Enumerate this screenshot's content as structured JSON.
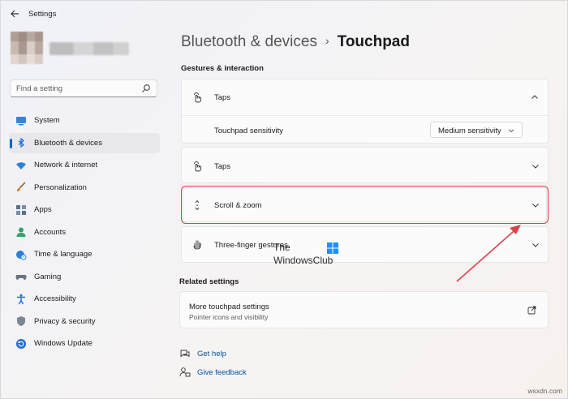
{
  "window": {
    "title": "Settings"
  },
  "search": {
    "placeholder": "Find a setting"
  },
  "sidebar": {
    "items": [
      {
        "label": "System",
        "icon": "system-icon"
      },
      {
        "label": "Bluetooth & devices",
        "icon": "bluetooth-icon",
        "active": true
      },
      {
        "label": "Network & internet",
        "icon": "wifi-icon"
      },
      {
        "label": "Personalization",
        "icon": "brush-icon"
      },
      {
        "label": "Apps",
        "icon": "apps-icon"
      },
      {
        "label": "Accounts",
        "icon": "person-icon"
      },
      {
        "label": "Time & language",
        "icon": "globe-clock-icon"
      },
      {
        "label": "Gaming",
        "icon": "controller-icon"
      },
      {
        "label": "Accessibility",
        "icon": "accessibility-icon"
      },
      {
        "label": "Privacy & security",
        "icon": "shield-icon"
      },
      {
        "label": "Windows Update",
        "icon": "update-icon"
      }
    ]
  },
  "header": {
    "parent": "Bluetooth & devices",
    "separator": "›",
    "current": "Touchpad"
  },
  "gestures": {
    "section_title": "Gestures & interaction",
    "taps_expanded": {
      "label": "Taps",
      "sensitivity_label": "Touchpad sensitivity",
      "sensitivity_value": "Medium sensitivity"
    },
    "taps": {
      "label": "Taps"
    },
    "scroll_zoom": {
      "label": "Scroll & zoom"
    },
    "three_finger": {
      "label": "Three-finger gestures"
    }
  },
  "related": {
    "section_title": "Related settings",
    "more_touchpad": {
      "title": "More touchpad settings",
      "subtitle": "Pointer icons and visibility"
    }
  },
  "help": {
    "get_help": "Get help",
    "give_feedback": "Give feedback"
  },
  "watermark": {
    "line1": "The",
    "line2": "WindowsClub"
  },
  "site": "wsxdn.com",
  "colors": {
    "accent": "#0067c0",
    "highlight_border": "#d9434b",
    "link": "#0052a3"
  }
}
